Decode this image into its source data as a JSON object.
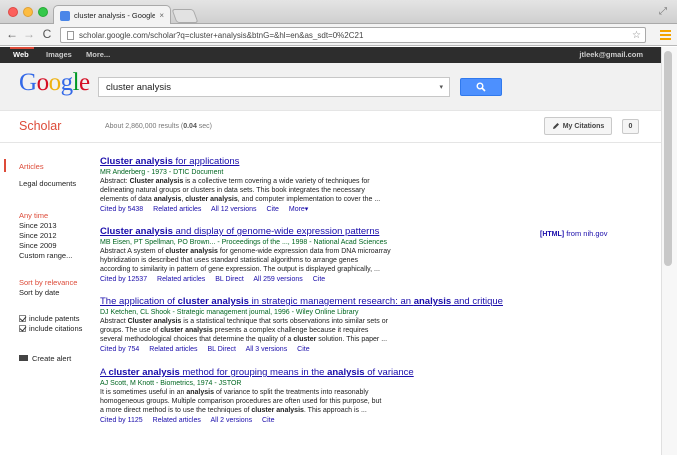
{
  "browser": {
    "tab_title": "cluster analysis - Google Sch",
    "tab_close": "×",
    "url": "scholar.google.com/scholar?q=cluster+analysis&btnG=&hl=en&as_sdt=0%2C21",
    "back": "←",
    "forward": "→",
    "reload": "C",
    "star": "☆",
    "resize": "⤢"
  },
  "gbar": {
    "web": "Web",
    "images": "Images",
    "more": "More...",
    "account": "jtleek@gmail.com"
  },
  "search": {
    "logo": [
      "G",
      "o",
      "o",
      "g",
      "l",
      "e"
    ],
    "query": "cluster analysis",
    "dropdown_arrow": "▾"
  },
  "scholar": {
    "title": "Scholar",
    "count_prefix": "About 2,860,000 results (",
    "count_time": "0.04",
    "count_suffix": " sec)",
    "my_citations": "My Citations",
    "alert_count": "0"
  },
  "sidebar": {
    "articles": "Articles",
    "legal": "Legal documents",
    "any_time": "Any time",
    "since_2013": "Since 2013",
    "since_2012": "Since 2012",
    "since_2009": "Since 2009",
    "custom_range": "Custom range...",
    "sort_relevance": "Sort by relevance",
    "sort_date": "Sort by date",
    "include_patents": "include patents",
    "include_citations": "include citations",
    "create_alert": "Create alert"
  },
  "results": [
    {
      "title_bold": "Cluster analysis",
      "title_rest": " for applications",
      "meta": "MR Anderberg - 1973 - DTIC Document",
      "snippet1_a": "Abstract: ",
      "snippet1_b": "Cluster analysis",
      "snippet1_c": " is a collective term covering a wide variety of techniques for",
      "snippet2": "delineating natural groups or clusters in data sets. This book integrates the necessary",
      "snippet3_a": "elements of data ",
      "snippet3_b": "analysis",
      "snippet3_c": ", ",
      "snippet3_d": "cluster analysis",
      "snippet3_e": ", and computer implementation to cover the ...",
      "cited_by": "Cited by 5438",
      "related": "Related articles",
      "versions": "All 12 versions",
      "cite": "Cite",
      "more": "More▾"
    },
    {
      "title_bold": "Cluster analysis",
      "title_rest": " and display of genome-wide expression patterns",
      "meta": "MB Eisen, PT Spellman, PO Brown... - Proceedings of the ..., 1998 - National Acad Sciences",
      "snippet1_a": "Abstract A system of ",
      "snippet1_b": "cluster analysis",
      "snippet1_c": " for genome-wide expression data from DNA microarray",
      "snippet2": "hybridization is described that uses standard statistical algorithms to arrange genes",
      "snippet3": "according to similarity in pattern of gene expression. The output is displayed graphically, ...",
      "cited_by": "Cited by 12537",
      "related": "Related articles",
      "bl_direct": "BL Direct",
      "versions": "All 259 versions",
      "cite": "Cite",
      "html_tag": "[HTML]",
      "html_source": " from nih.gov"
    },
    {
      "title_a": "The application of ",
      "title_b": "cluster analysis",
      "title_c": " in strategic management research: an ",
      "title_d": "analysis",
      "title_e": " and critique",
      "meta": "DJ Ketchen, CL Shook - Strategic management journal, 1996 - Wiley Online Library",
      "snippet1_a": "Abstract ",
      "snippet1_b": "Cluster analysis",
      "snippet1_c": " is a statistical technique that sorts observations into similar sets or",
      "snippet2_a": "groups. The use of ",
      "snippet2_b": "cluster analysis",
      "snippet2_c": " presents a complex challenge because it requires",
      "snippet3_a": "several methodological choices that determine the quality of a ",
      "snippet3_b": "cluster",
      "snippet3_c": " solution. This paper ...",
      "cited_by": "Cited by 754",
      "related": "Related articles",
      "bl_direct": "BL Direct",
      "versions": "All 3 versions",
      "cite": "Cite"
    },
    {
      "title_a": "A ",
      "title_b": "cluster analysis",
      "title_c": " method for grouping means in the ",
      "title_d": "analysis",
      "title_e": " of variance",
      "meta": "AJ Scott, M Knott - Biometrics, 1974 - JSTOR",
      "snippet1_a": "It is sometimes useful in an ",
      "snippet1_b": "analysis",
      "snippet1_c": " of variance to split the treatments into reasonably",
      "snippet2": "homogeneous groups. Multiple comparison procedures are often used for this purpose, but",
      "snippet3_a": "a more direct method is to use the techniques of ",
      "snippet3_b": "cluster analysis",
      "snippet3_c": ". This approach is ...",
      "cited_by": "Cited by 1125",
      "related": "Related articles",
      "versions": "All 2 versions",
      "cite": "Cite"
    }
  ]
}
